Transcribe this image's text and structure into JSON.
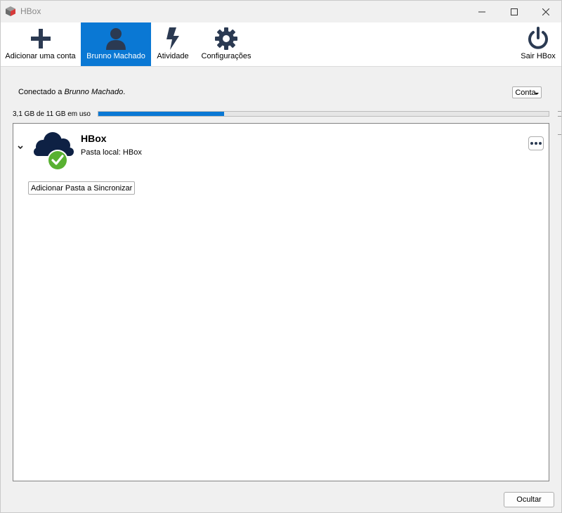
{
  "window": {
    "title": "HBox"
  },
  "toolbar": {
    "items": [
      {
        "label": "Adicionar uma conta",
        "icon": "plus-icon"
      },
      {
        "label": "Brunno Machado",
        "icon": "user-icon",
        "active": true
      },
      {
        "label": "Atividade",
        "icon": "lightning-icon"
      },
      {
        "label": "Configurações",
        "icon": "gear-icon"
      }
    ],
    "quit": {
      "label": "Sair HBox",
      "icon": "power-icon"
    }
  },
  "account": {
    "connected_prefix": "Conectado a ",
    "user": "Brunno Machado",
    "connected_suffix": ".",
    "menu_label": "Conta"
  },
  "storage": {
    "usage_text": "3,1 GB de 11 GB em uso",
    "used_fraction": 0.28
  },
  "folder": {
    "name": "HBox",
    "local_path": "Pasta local: HBox",
    "add_button": "Adicionar Pasta a Sincronizar",
    "status_icon": "check-icon"
  },
  "footer": {
    "hide_label": "Ocultar"
  },
  "colors": {
    "accent": "#0a78d4",
    "icon_dark": "#2b3a52",
    "cloud": "#0e2144",
    "ok_green": "#58b131"
  }
}
